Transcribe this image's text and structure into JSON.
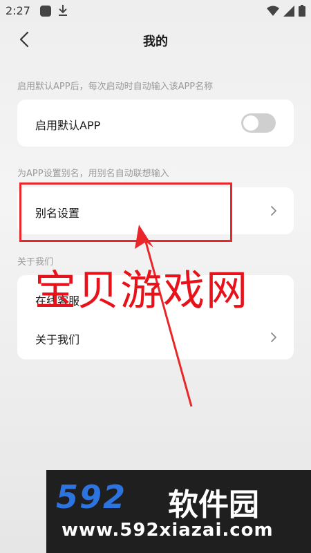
{
  "status_bar": {
    "time": "2:27"
  },
  "header": {
    "title": "我的"
  },
  "sections": {
    "default_app": {
      "hint": "启用默认APP后，每次启动时自动输入该APP名称",
      "row_label": "启用默认APP",
      "toggle_on": false
    },
    "alias": {
      "hint": "为APP设置别名，用别名自动联想输入",
      "row_label": "别名设置"
    },
    "about": {
      "hint": "关于我们",
      "rows": [
        {
          "label": "在线客服"
        },
        {
          "label": "关于我们"
        }
      ]
    }
  },
  "watermark": {
    "text": "宝贝游戏网"
  },
  "banner": {
    "brand_number": "592",
    "brand_cn": "软件园",
    "url": "www.592xiazai.com"
  },
  "colors": {
    "annotation": "#e8272a",
    "brand_blue": "#2c74e0"
  }
}
